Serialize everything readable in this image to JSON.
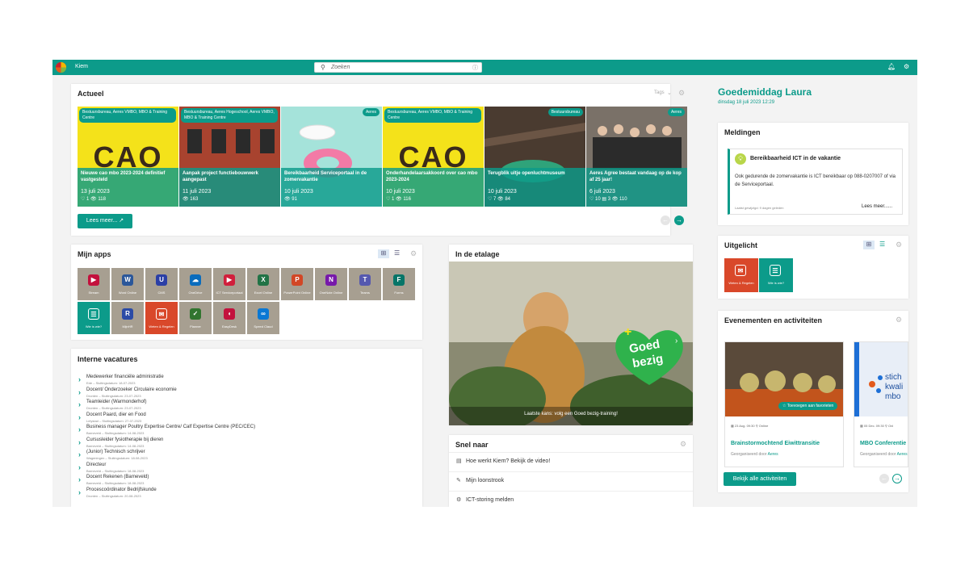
{
  "topbar": {
    "brand": "Kiem",
    "search_placeholder": "Zoeken"
  },
  "actueel": {
    "title": "Actueel",
    "filter_label": "Tags",
    "read_more": "Lees meer...",
    "items": [
      {
        "tag": "Bestuursbureau, Aeres VMBO, MBO & Training Centre",
        "title": "Nieuwe cao mbo 2023-2024 definitief vastgesteld",
        "date": "13 juli 2023",
        "meta": "♡ 1 👁 118"
      },
      {
        "tag": "Bestuursbureau, Aeres Hogeschool, Aeres VMBO, MBO & Training Centre",
        "title": "Aanpak project functiebouwwerk aangepast",
        "date": "11 juli 2023",
        "meta": "👁 163"
      },
      {
        "tag": "Aeres",
        "title": "Bereikbaarheid Serviceportaal in de zomervakantie",
        "date": "10 juli 2023",
        "meta": "👁 91"
      },
      {
        "tag": "Bestuursbureau, Aeres VMBO, MBO & Training Centre",
        "title": "Onderhandelaarsakkoord over cao mbo 2023-2024",
        "date": "10 juli 2023",
        "meta": "♡ 1 👁 116"
      },
      {
        "tag": "Bestuursbureau",
        "title": "Terugblik uitje openluchtmuseum",
        "date": "10 juli 2023",
        "meta": "♡ 7 👁 84"
      },
      {
        "tag": "Aeres",
        "title": "Aeres Agree bestaat vandaag op de kop af 25 jaar!",
        "date": "6 juli 2023",
        "meta": "♡ 10 ▤ 3 👁 110"
      }
    ]
  },
  "apps": {
    "title": "Mijn apps",
    "items": [
      {
        "label": "Stream",
        "icon": "▶",
        "color": "#c3113d",
        "bg": "#a79f91"
      },
      {
        "label": "Word Online",
        "icon": "W",
        "color": "#2b579a",
        "bg": "#a79f91"
      },
      {
        "label": "CMS",
        "icon": "U",
        "color": "#2b3fa6",
        "bg": "#a79f91"
      },
      {
        "label": "OneDrive",
        "icon": "☁",
        "color": "#0a6cbd",
        "bg": "#a79f91"
      },
      {
        "label": "ICT Serviceportaal",
        "icon": "▶",
        "color": "#d11f3c",
        "bg": "#a79f91"
      },
      {
        "label": "Excel Online",
        "icon": "X",
        "color": "#217346",
        "bg": "#a79f91"
      },
      {
        "label": "PowerPoint Online",
        "icon": "P",
        "color": "#d24726",
        "bg": "#a79f91"
      },
      {
        "label": "OneNote Online",
        "icon": "N",
        "color": "#7719aa",
        "bg": "#a79f91"
      },
      {
        "label": "Teams",
        "icon": "T",
        "color": "#5558af",
        "bg": "#a79f91"
      },
      {
        "label": "Forms",
        "icon": "F",
        "color": "#077568",
        "bg": "#a79f91"
      },
      {
        "label": "Wie is wie?",
        "icon": "☰",
        "color": "#0c9b8a",
        "bg": "#0c9b8a"
      },
      {
        "label": "MijnHR",
        "icon": "R",
        "color": "#2b4ba6",
        "bg": "#a79f91"
      },
      {
        "label": "Weten & Regelen",
        "icon": "✉",
        "color": "#d9482a",
        "bg": "#d9482a"
      },
      {
        "label": "Planner",
        "icon": "✓",
        "color": "#31752f",
        "bg": "#a79f91"
      },
      {
        "label": "EasyDesk",
        "icon": "◖",
        "color": "#c3113d",
        "bg": "#a79f91"
      },
      {
        "label": "Speed Claud",
        "icon": "∞",
        "color": "#0a78d4",
        "bg": "#a79f91"
      }
    ]
  },
  "vacatures": {
    "title": "Interne vacatures",
    "items": [
      {
        "title": "Medewerker financiële administratie",
        "sub": "Ede – Sluitingsdatum: 18-07-2023"
      },
      {
        "title": "Docent/ Onderzoeker Circulaire economie",
        "sub": "Dronten – Sluitingsdatum: 23-07-2023"
      },
      {
        "title": "Teamleider (Warmonderhof)",
        "sub": "Dronten – Sluitingsdatum: 23-07-2023"
      },
      {
        "title": "Docent Paard, dier en Food",
        "sub": "Lelystad – Sluitingsdatum: 27-07-2023"
      },
      {
        "title": "Business manager Poultry Expertise Centre/ Calf Expertise Centre (PEC/CEC)",
        "sub": "Barneveld – Sluitingsdatum: 14-08-2023"
      },
      {
        "title": "Cursusleider fysiotherapie bij dieren",
        "sub": "Barneveld – Sluitingsdatum: 14-08-2023"
      },
      {
        "title": "(Junior) Technisch schrijver",
        "sub": "Wageningen – Sluitingsdatum: 18-08-2023"
      },
      {
        "title": "Directeur",
        "sub": "Barneveld – Sluitingsdatum: 18-08-2023"
      },
      {
        "title": "Docent Rekenen (Barneveld)",
        "sub": "Barneveld – Sluitingsdatum: 18-08-2023"
      },
      {
        "title": "Procescoördinator Bedrijfskunde",
        "sub": "Dronten – Sluitingsdatum: 20-08-2023"
      }
    ]
  },
  "etalage": {
    "title": "In de etalage",
    "caption": "Laatste kans: volg een Goed bezig-training!",
    "badge_line1": "Goed",
    "badge_line2": "bezig"
  },
  "snel": {
    "title": "Snel naar",
    "items": [
      {
        "icon": "doc-icon",
        "glyph": "▤",
        "label": "Hoe werkt Kiem? Bekijk de video!"
      },
      {
        "icon": "money-icon",
        "glyph": "✎",
        "label": "Mijn loonstrook"
      },
      {
        "icon": "tool-icon",
        "glyph": "⚙",
        "label": "ICT-storing melden"
      }
    ]
  },
  "greeting": {
    "title": "Goedemiddag Laura",
    "date": "dinsdag 18 juli 2023 12:29"
  },
  "meldingen": {
    "title": "Meldingen",
    "item_title": "Bereikbaarheid ICT in de vakantie",
    "item_text": "Ook gedurende de zomervakantie is ICT bereikbaar op 088-0207007 of via de Serviceportaal.",
    "updated": "Laatst gewijzigd: 9 dagen geleden",
    "more": "Lees meer......"
  },
  "uitgelicht": {
    "title": "Uitgelicht",
    "items": [
      {
        "label": "Weten & Regelen",
        "icon": "✉",
        "bg": "#d9482a"
      },
      {
        "label": "Wie is wie?",
        "icon": "☰",
        "bg": "#0c9b8a"
      }
    ]
  },
  "evenementen": {
    "title": "Evenementen en activiteiten",
    "all_button": "Bekijk alle activiteiten",
    "items": [
      {
        "badge": "Toevoegen aan favorieten",
        "date": "23 Aug. 09:30",
        "loc": "Online",
        "title": "Brainstormochtend Eiwittransitie",
        "org_prefix": "Georganiseerd door",
        "org": "Aeres"
      },
      {
        "badge": "",
        "date": "05 Dec. 09:30",
        "loc": "Onl",
        "title": "MBO Conferentie",
        "org_prefix": "Georganiseerd door",
        "org": "Aeres"
      }
    ]
  },
  "colors": {
    "brand": "#0c9b8a",
    "app_tile": "#a79f91",
    "accent_orange": "#d9482a"
  }
}
